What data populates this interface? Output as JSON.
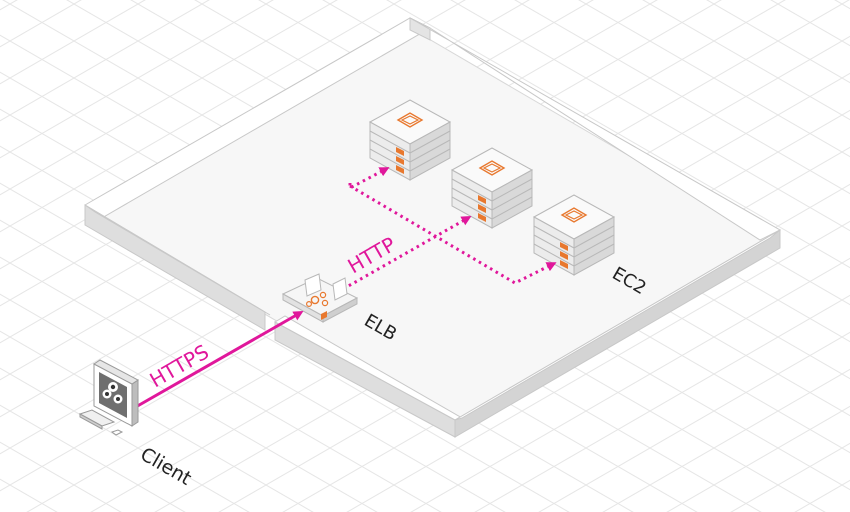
{
  "diagram": {
    "labels": {
      "client": "Client",
      "elb": "ELB",
      "ec2": "EC2",
      "https": "HTTPS",
      "http": "HTTP"
    },
    "colors": {
      "connector": "#e0179b",
      "accent": "#e8782e",
      "platform_top": "#f8f8f8",
      "platform_wall": "#dcdcdc",
      "grid": "#e6e6e6"
    },
    "icons": {
      "client": "client-computer-icon",
      "elb": "elastic-load-balancer-icon",
      "ec2": "ec2-instance-stack-icon"
    }
  }
}
